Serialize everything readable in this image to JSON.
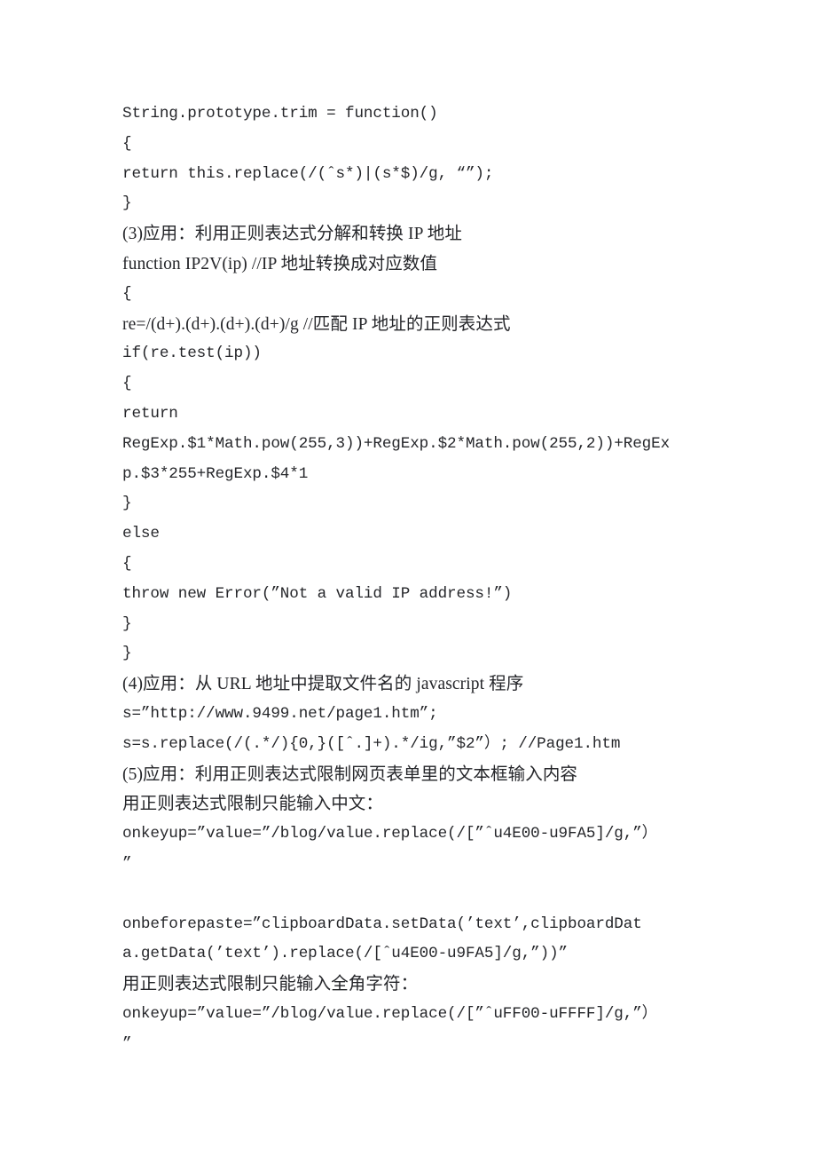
{
  "document": {
    "type": "scanned-text-page",
    "page_background": "#ffffff",
    "text_color": "#25262a",
    "lines": [
      {
        "id": "l01",
        "style": "code",
        "text": "String.prototype.trim = function()"
      },
      {
        "id": "l02",
        "style": "code",
        "text": "{"
      },
      {
        "id": "l03",
        "style": "code",
        "text": "return this.replace(/(ˆs*)|(s*$)/g, “”);"
      },
      {
        "id": "l04",
        "style": "code",
        "text": "}"
      },
      {
        "id": "l05",
        "style": "mixed",
        "text": "(3)应用：利用正则表达式分解和转换 IP 地址"
      },
      {
        "id": "l06",
        "style": "mixed",
        "text": "function IP2V(ip) //IP 地址转换成对应数值"
      },
      {
        "id": "l07",
        "style": "code",
        "text": "{"
      },
      {
        "id": "l08",
        "style": "mixed",
        "text": "re=/(d+).(d+).(d+).(d+)/g //匹配 IP 地址的正则表达式"
      },
      {
        "id": "l09",
        "style": "code",
        "text": "if(re.test(ip))"
      },
      {
        "id": "l10",
        "style": "code",
        "text": "{"
      },
      {
        "id": "l11",
        "style": "code",
        "text": "return"
      },
      {
        "id": "l12",
        "style": "code",
        "text": "RegExp.$1*Math.pow(255,3))+RegExp.$2*Math.pow(255,2))+RegEx"
      },
      {
        "id": "l13",
        "style": "code",
        "text": "p.$3*255+RegExp.$4*1"
      },
      {
        "id": "l14",
        "style": "code",
        "text": "}"
      },
      {
        "id": "l15",
        "style": "code",
        "text": "else"
      },
      {
        "id": "l16",
        "style": "code",
        "text": "{"
      },
      {
        "id": "l17",
        "style": "code",
        "text": "throw new Error(”Not a valid IP address!”)"
      },
      {
        "id": "l18",
        "style": "code",
        "text": "}"
      },
      {
        "id": "l19",
        "style": "code",
        "text": "}"
      },
      {
        "id": "l20",
        "style": "mixed",
        "text": "(4)应用：从 URL 地址中提取文件名的 javascript 程序"
      },
      {
        "id": "l21",
        "style": "code",
        "text": "s=”http://www.9499.net/page1.htm”;"
      },
      {
        "id": "l22",
        "style": "code",
        "text": "s=s.replace(/(.*/){0,}([ˆ.]+).*/ig,”$2”）; //Page1.htm"
      },
      {
        "id": "l23",
        "style": "mixed",
        "text": "(5)应用：利用正则表达式限制网页表单里的文本框输入内容"
      },
      {
        "id": "l24",
        "style": "mixed",
        "text": "用正则表达式限制只能输入中文："
      },
      {
        "id": "l25",
        "style": "code",
        "text": "onkeyup=”value=”/blog/value.replace(/[”ˆu4E00-u9FA5]/g,”）"
      },
      {
        "id": "l26",
        "style": "code",
        "text": "”"
      },
      {
        "id": "l27",
        "style": "blank",
        "text": ""
      },
      {
        "id": "l28",
        "style": "code",
        "text": "onbeforepaste=”clipboardData.setData(’text’,clipboardDat"
      },
      {
        "id": "l29",
        "style": "code",
        "text": "a.getData(’text’).replace(/[ˆu4E00-u9FA5]/g,”))”"
      },
      {
        "id": "l30",
        "style": "mixed",
        "text": "用正则表达式限制只能输入全角字符："
      },
      {
        "id": "l31",
        "style": "code",
        "text": "onkeyup=”value=”/blog/value.replace(/[”ˆuFF00-uFFFF]/g,”）"
      },
      {
        "id": "l32",
        "style": "code",
        "text": "”"
      }
    ]
  }
}
